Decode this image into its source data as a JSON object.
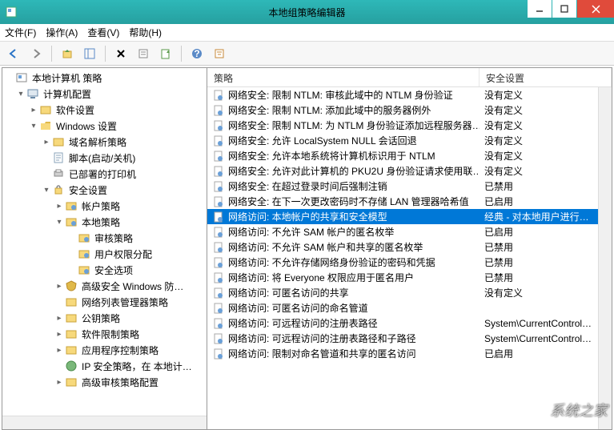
{
  "window": {
    "title": "本地组策略编辑器"
  },
  "menu": {
    "file": "文件(F)",
    "action": "操作(A)",
    "view": "查看(V)",
    "help": "帮助(H)"
  },
  "tree": {
    "root": "本地计算机 策略",
    "computer_config": "计算机配置",
    "software_settings": "软件设置",
    "windows_settings": "Windows 设置",
    "name_resolution": "域名解析策略",
    "scripts": "脚本(启动/关机)",
    "deployed_printers": "已部署的打印机",
    "security_settings": "安全设置",
    "account_policy": "帐户策略",
    "local_policy": "本地策略",
    "audit_policy": "审核策略",
    "user_rights": "用户权限分配",
    "security_options": "安全选项",
    "adv_firewall": "高级安全 Windows 防…",
    "nlm_policy": "网络列表管理器策略",
    "pubkey_policy": "公钥策略",
    "sw_restrict": "软件限制策略",
    "app_control": "应用程序控制策略",
    "ip_sec": "IP 安全策略，在 本地计…",
    "adv_audit": "高级审核策略配置"
  },
  "list": {
    "col_policy": "策略",
    "col_setting": "安全设置",
    "rows": [
      {
        "p": "网络安全: 限制 NTLM: 审核此域中的 NTLM 身份验证",
        "s": "没有定义"
      },
      {
        "p": "网络安全: 限制 NTLM: 添加此域中的服务器例外",
        "s": "没有定义"
      },
      {
        "p": "网络安全: 限制 NTLM: 为 NTLM 身份验证添加远程服务器…",
        "s": "没有定义"
      },
      {
        "p": "网络安全: 允许 LocalSystem NULL 会话回退",
        "s": "没有定义"
      },
      {
        "p": "网络安全: 允许本地系统将计算机标识用于 NTLM",
        "s": "没有定义"
      },
      {
        "p": "网络安全: 允许对此计算机的 PKU2U 身份验证请求使用联…",
        "s": "没有定义"
      },
      {
        "p": "网络安全: 在超过登录时间后强制注销",
        "s": "已禁用"
      },
      {
        "p": "网络安全: 在下一次更改密码时不存储 LAN 管理器哈希值",
        "s": "已启用"
      },
      {
        "p": "网络访问: 本地帐户的共享和安全模型",
        "s": "经典 - 对本地用户进行…"
      },
      {
        "p": "网络访问: 不允许 SAM 帐户的匿名枚举",
        "s": "已启用"
      },
      {
        "p": "网络访问: 不允许 SAM 帐户和共享的匿名枚举",
        "s": "已禁用"
      },
      {
        "p": "网络访问: 不允许存储网络身份验证的密码和凭据",
        "s": "已禁用"
      },
      {
        "p": "网络访问: 将 Everyone 权限应用于匿名用户",
        "s": "已禁用"
      },
      {
        "p": "网络访问: 可匿名访问的共享",
        "s": "没有定义"
      },
      {
        "p": "网络访问: 可匿名访问的命名管道",
        "s": ""
      },
      {
        "p": "网络访问: 可远程访问的注册表路径",
        "s": "System\\CurrentControl…"
      },
      {
        "p": "网络访问: 可远程访问的注册表路径和子路径",
        "s": "System\\CurrentControl…"
      },
      {
        "p": "网络访问: 限制对命名管道和共享的匿名访问",
        "s": "已启用"
      }
    ],
    "selected_index": 8
  },
  "watermark": "系统之家"
}
